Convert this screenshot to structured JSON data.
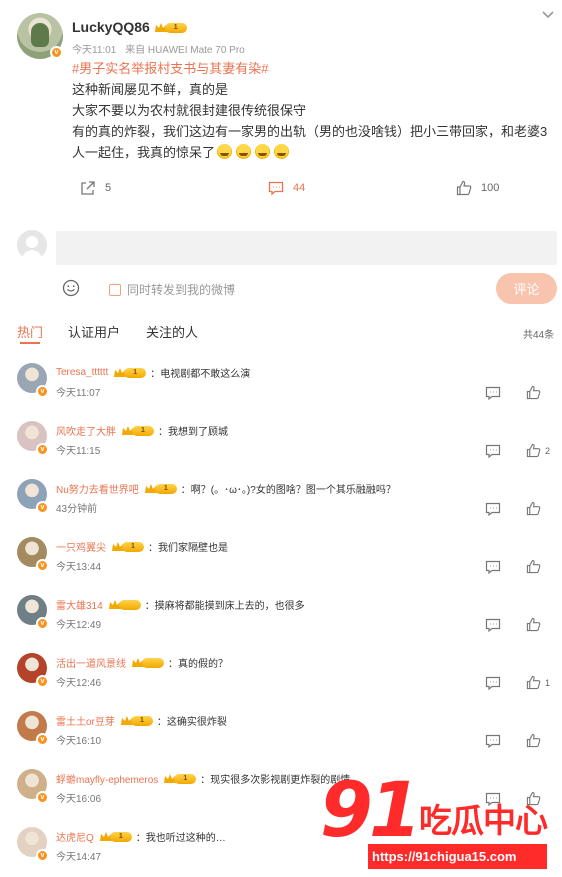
{
  "post": {
    "username": "LuckyQQ86",
    "level": "1",
    "time": "今天11:01",
    "source": "来自 HUAWEI Mate 70 Pro",
    "hashtag": "#男子实名举报村支书与其妻有染#",
    "lines": [
      "这种新闻屡见不鲜，真的是",
      "大家不要以为农村就很封建很传统很保守",
      "有的真的炸裂，我们这边有一家男的出轨（男的也没啥钱）把小三带回家，和老婆3人一起住，我真的惊呆了"
    ],
    "emojis": [
      "laugh-cry-emoji",
      "laugh-cry-emoji",
      "laugh-cry-emoji",
      "laugh-cry-emoji"
    ],
    "repost_count": "5",
    "comment_count": "44",
    "like_count": "100"
  },
  "composer": {
    "input_value": "",
    "repost_label": "同时转发到我的微博",
    "submit_label": "评论"
  },
  "tabs": {
    "items": [
      "热门",
      "认证用户",
      "关注的人"
    ],
    "total": "共44条"
  },
  "comments": [
    {
      "name": "Teresa_tttttt",
      "level": "1",
      "text": "：电视剧都不敢这么演",
      "time": "今天11:07",
      "likes": "",
      "avatar_color": "#9aa6b4"
    },
    {
      "name": "风吹走了大胖",
      "level": "1",
      "text": "：我想到了顾城",
      "time": "今天11:15",
      "likes": "2",
      "avatar_color": "#d9c2c2"
    },
    {
      "name": "Nu努力去看世界吧",
      "level": "1",
      "text": "：啊？(。･ω･。)?女的图啥？图一个其乐融融吗？",
      "time": "43分钟前",
      "likes": "",
      "avatar_color": "#8fa3b8"
    },
    {
      "name": "一只鸡翼尖",
      "level": "1",
      "text": "：我们家隔壁也是",
      "time": "今天13:44",
      "likes": "",
      "avatar_color": "#a38a5f"
    },
    {
      "name": "雷大雄314",
      "level": "",
      "text": "：摸麻将都能摸到床上去的，也很多",
      "time": "今天12:49",
      "likes": "",
      "avatar_color": "#6e7f86"
    },
    {
      "name": "活出一道风景线",
      "level": "",
      "text": "：真的假的？",
      "time": "今天12:46",
      "likes": "1",
      "avatar_color": "#b5432a"
    },
    {
      "name": "雷土土or豆芽",
      "level": "1",
      "text": "：这确实很炸裂",
      "time": "今天16:10",
      "likes": "",
      "avatar_color": "#c27a4a"
    },
    {
      "name": "蜉蝣mayfly-ephemeros",
      "level": "1",
      "text": "：现实很多次影视剧更炸裂的剧情",
      "time": "今天16:06",
      "likes": "",
      "avatar_color": "#d0b08a"
    },
    {
      "name": "达虎尼Q",
      "level": "1",
      "text": "：我也听过这种的…",
      "time": "今天14:47",
      "likes": "",
      "avatar_color": "#e3d2c2"
    }
  ],
  "watermark": {
    "brand_number": "91",
    "brand_text": "吃瓜中心",
    "url": "https://91chigua15.com"
  },
  "colors": {
    "accent": "#eb7350",
    "badge": "#f7931e",
    "watermark": "#ff2a2a"
  }
}
